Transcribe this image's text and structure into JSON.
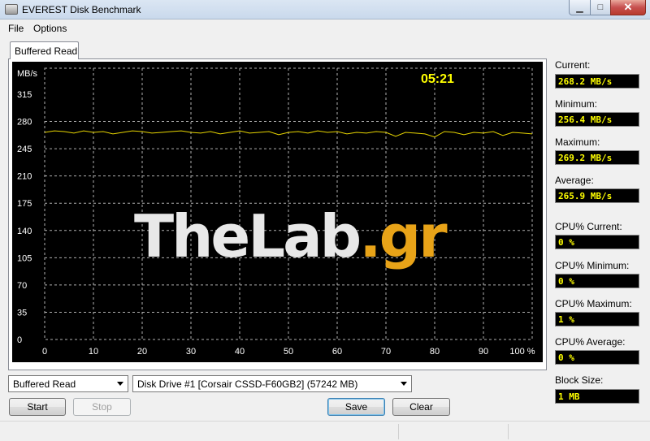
{
  "window": {
    "title": "EVEREST Disk Benchmark"
  },
  "menu": {
    "file": "File",
    "options": "Options"
  },
  "tab": {
    "label": "Buffered Read"
  },
  "chart_data": {
    "type": "line",
    "unit_label": "MB/s",
    "timer": "05:21",
    "watermark": {
      "part1": "TheLab",
      "part2": ".gr"
    },
    "y_ticks": [
      "315",
      "280",
      "245",
      "210",
      "175",
      "140",
      "105",
      "70",
      "35",
      "0"
    ],
    "x_ticks": [
      "0",
      "10",
      "20",
      "30",
      "40",
      "50",
      "60",
      "70",
      "80",
      "90",
      "100 %"
    ],
    "ylim": [
      0,
      315
    ],
    "xlim": [
      0,
      100
    ],
    "grid": true,
    "line_color": "#e6d400",
    "series": [
      {
        "x": [
          0,
          2,
          4,
          6,
          8,
          10,
          12,
          14,
          16,
          18,
          20,
          22,
          24,
          26,
          28,
          30,
          32,
          34,
          36,
          38,
          40,
          42,
          44,
          46,
          48,
          50,
          52,
          54,
          56,
          58,
          60,
          62,
          64,
          66,
          68,
          70,
          72,
          74,
          76,
          78,
          80,
          82,
          84,
          86,
          88,
          90,
          92,
          94,
          96,
          98,
          100
        ],
        "values": [
          266,
          268,
          267,
          265,
          268,
          266,
          267,
          264,
          266,
          268,
          267,
          265,
          266,
          267,
          268,
          266,
          265,
          267,
          264,
          266,
          268,
          265,
          266,
          267,
          263,
          266,
          267,
          265,
          268,
          266,
          267,
          264,
          266,
          265,
          267,
          266,
          261,
          266,
          265,
          264,
          260,
          267,
          266,
          263,
          266,
          265,
          267,
          262,
          266,
          265,
          264
        ]
      }
    ]
  },
  "stats": {
    "current_label": "Current:",
    "current_value": "268.2 MB/s",
    "minimum_label": "Minimum:",
    "minimum_value": "256.4 MB/s",
    "maximum_label": "Maximum:",
    "maximum_value": "269.2 MB/s",
    "average_label": "Average:",
    "average_value": "265.9 MB/s",
    "cpu_current_label": "CPU% Current:",
    "cpu_current_value": "0 %",
    "cpu_minimum_label": "CPU% Minimum:",
    "cpu_minimum_value": "0 %",
    "cpu_maximum_label": "CPU% Maximum:",
    "cpu_maximum_value": "1 %",
    "cpu_average_label": "CPU% Average:",
    "cpu_average_value": "0 %",
    "block_size_label": "Block Size:",
    "block_size_value": "1 MB"
  },
  "controls": {
    "test_select": "Buffered Read",
    "drive_select": "Disk Drive #1  [Corsair CSSD-F60GB2]  (57242 MB)",
    "start": "Start",
    "stop": "Stop",
    "save": "Save",
    "clear": "Clear"
  }
}
